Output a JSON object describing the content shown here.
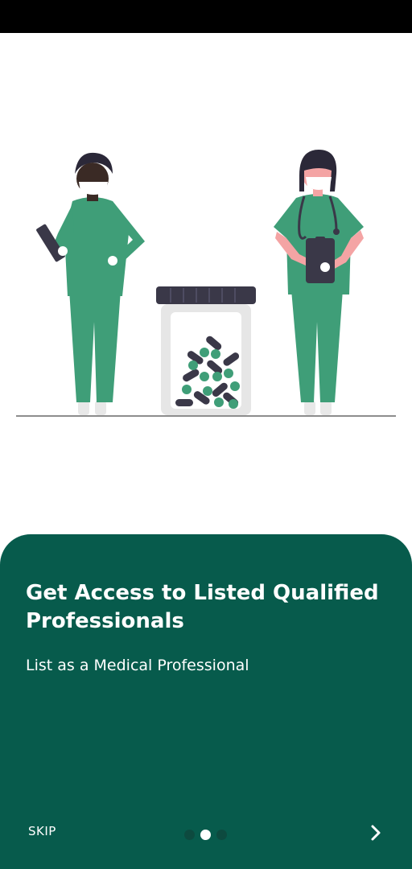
{
  "onboarding": {
    "title": "Get Access to Listed Qualified Professionals",
    "subtitle": "List as a Medical Professional",
    "skip_label": "SKIP",
    "page_count": 3,
    "active_page": 2
  },
  "illustration": {
    "subject": "two masked medical professionals beside a pill jar",
    "icons": [
      "doctor-illustration",
      "nurse-illustration",
      "pill-jar-illustration",
      "stethoscope-icon",
      "tablet-icon",
      "chevron-right-icon"
    ]
  },
  "colors": {
    "card_background": "#075b4c",
    "scrubs": "#3f9e78",
    "dark_accent": "#3a3848",
    "text": "#ffffff"
  }
}
